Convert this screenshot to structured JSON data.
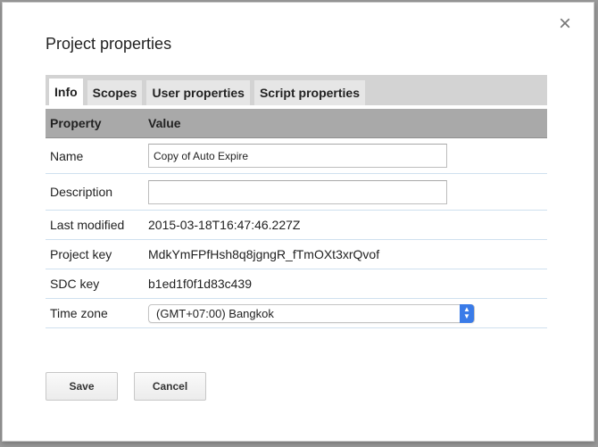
{
  "dialog": {
    "title": "Project properties",
    "close_label": "×"
  },
  "tabs": [
    {
      "label": "Info",
      "active": true
    },
    {
      "label": "Scopes",
      "active": false
    },
    {
      "label": "User properties",
      "active": false
    },
    {
      "label": "Script properties",
      "active": false
    }
  ],
  "table": {
    "headers": [
      "Property",
      "Value"
    ],
    "rows": [
      {
        "property": "Name",
        "value": "Copy of Auto Expire",
        "type": "text-input"
      },
      {
        "property": "Description",
        "value": "",
        "type": "text-input"
      },
      {
        "property": "Last modified",
        "value": "2015-03-18T16:47:46.227Z",
        "type": "text"
      },
      {
        "property": "Project key",
        "value": "MdkYmFPfHsh8q8jgngR_fTmOXt3xrQvof",
        "type": "text"
      },
      {
        "property": "SDC key",
        "value": "b1ed1f0f1d83c439",
        "type": "text"
      },
      {
        "property": "Time zone",
        "value": "(GMT+07:00) Bangkok",
        "type": "select"
      }
    ]
  },
  "buttons": {
    "save": "Save",
    "cancel": "Cancel"
  },
  "icons": {
    "close": "close-icon",
    "select_arrows": "select-arrows-icon"
  },
  "colors": {
    "header_bg": "#a9a9a9",
    "tabbar_bg": "#d3d3d3",
    "select_accent": "#3a7be8"
  }
}
